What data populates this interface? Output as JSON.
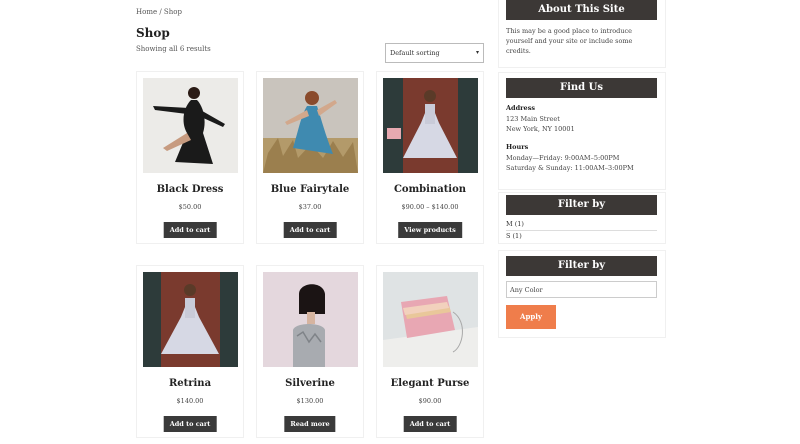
{
  "breadcrumb": {
    "home": "Home",
    "separator": " / ",
    "current": "Shop"
  },
  "page_title": "Shop",
  "result_count": "Showing all 6 results",
  "sorting": {
    "selected": "Default sorting"
  },
  "products": [
    {
      "name": "Black Dress",
      "price": "$50.00",
      "button": "Add to cart"
    },
    {
      "name": "Blue Fairytale",
      "price": "$37.00",
      "button": "Add to cart"
    },
    {
      "name": "Combination",
      "price": "$90.00 – $140.00",
      "button": "View products"
    },
    {
      "name": "Retrina",
      "price": "$140.00",
      "button": "Add to cart"
    },
    {
      "name": "Silverine",
      "price": "$130.00",
      "button": "Read more"
    },
    {
      "name": "Elegant Purse",
      "price": "$90.00",
      "button": "Add to cart"
    }
  ],
  "sidebar": {
    "about": {
      "title": "About This Site",
      "text": "This may be a good place to introduce yourself and your site or include some credits."
    },
    "find_us": {
      "title": "Find Us",
      "address_label": "Address",
      "address_line1": "123 Main Street",
      "address_line2": "New York, NY 10001",
      "hours_label": "Hours",
      "hours_line1": "Monday—Friday: 9:00AM–5:00PM",
      "hours_line2": "Saturday & Sunday: 11:00AM–3:00PM"
    },
    "filter_size": {
      "title": "Filter by",
      "options": [
        "M (1)",
        "S (1)"
      ]
    },
    "filter_color": {
      "title": "Filter by",
      "placeholder": "Any Color",
      "apply": "Apply"
    }
  },
  "colors": {
    "widget_header": "#3c3836",
    "button": "#3a3a3a",
    "apply": "#ef7d4b"
  }
}
